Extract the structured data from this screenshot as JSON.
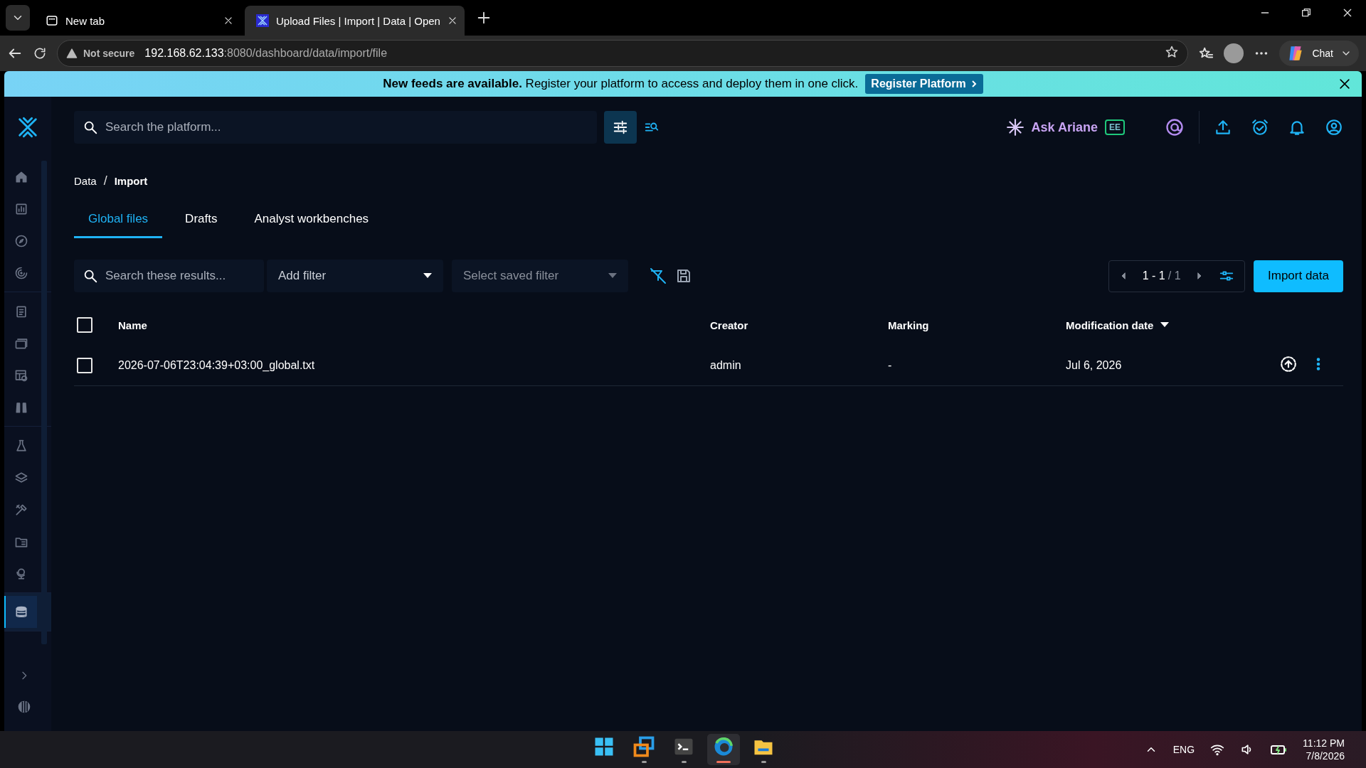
{
  "browser": {
    "tabs": [
      {
        "title": "New tab",
        "selected": false
      },
      {
        "title": "Upload Files | Import | Data | Open",
        "selected": true
      }
    ],
    "security": "Not secure",
    "url_host": "192.168.62.133",
    "url_rest": ":8080/dashboard/data/import/file",
    "chat_label": "Chat"
  },
  "banner": {
    "text": "**New feeds are available.** Register your platform to access and deploy them in one click.",
    "button": "Register Platform"
  },
  "sidebar": {
    "groups": [
      {
        "items": [
          {
            "selected": false
          },
          {
            "selected": false
          },
          {
            "selected": false
          },
          {
            "selected": false
          }
        ]
      },
      {
        "items": [
          {
            "selected": false
          },
          {
            "selected": false
          },
          {
            "selected": false
          },
          {
            "selected": false
          }
        ]
      },
      {
        "items": [
          {
            "selected": false
          },
          {
            "selected": false
          },
          {
            "selected": false
          },
          {
            "selected": false
          },
          {
            "selected": false
          }
        ]
      },
      {
        "items": [
          {
            "selected": true
          }
        ]
      }
    ]
  },
  "header": {
    "search": {
      "placeholder": "Search the platform..."
    },
    "assistant": "Ask Ariane",
    "edition_badge": "EE"
  },
  "breadcrumb": {
    "items": [
      "Data",
      "Import"
    ],
    "separator": "/"
  },
  "tabs": [
    {
      "label": "Global files",
      "selected": true
    },
    {
      "label": "Drafts",
      "selected": false
    },
    {
      "label": "Analyst workbenches",
      "selected": false
    }
  ],
  "toolbar": {
    "search": {
      "placeholder": "Search these results..."
    },
    "filter": {
      "placeholder": "Add filter",
      "disabled": false
    },
    "saved_filter": {
      "placeholder": "Select saved filter",
      "disabled": true
    },
    "pagination": {
      "range": "1 - 1",
      "total": "/ 1"
    },
    "import_button": "Import data"
  },
  "table": {
    "all_checked": false,
    "columns": [
      {
        "label": "Name",
        "sorted": false
      },
      {
        "label": "Creator",
        "sorted": false
      },
      {
        "label": "Marking",
        "sorted": false
      },
      {
        "label": "Modification date",
        "sorted": true
      }
    ],
    "rows": [
      {
        "checked": false,
        "cells": [
          "2026-07-06T23:04:39+03:00_global.txt",
          "admin",
          "-",
          "Jul 6, 2026"
        ]
      }
    ]
  },
  "taskbar": {
    "apps": [
      {
        "running": false,
        "active": false
      },
      {
        "running": true,
        "active": false
      },
      {
        "running": true,
        "active": false
      },
      {
        "running": true,
        "active": true
      },
      {
        "running": true,
        "active": false
      }
    ],
    "language": "ENG",
    "time": "11:12 PM",
    "date": "7/8/2026"
  }
}
